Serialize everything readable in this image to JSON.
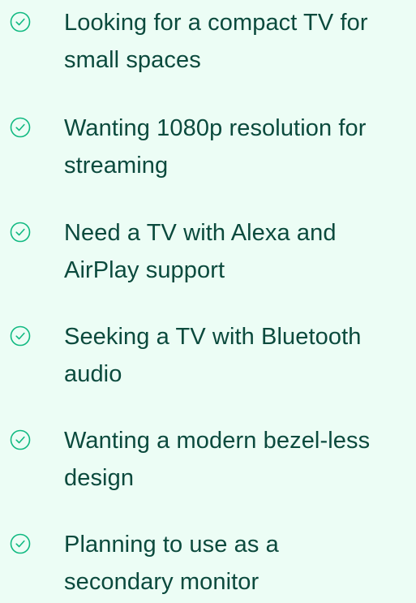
{
  "items": [
    {
      "line1": "Looking for a compact TV for",
      "line2": "small spaces"
    },
    {
      "line1": "Wanting 1080p resolution for",
      "line2": "streaming"
    },
    {
      "line1": "Need a TV with Alexa and",
      "line2": "AirPlay support"
    },
    {
      "line1": "Seeking a TV with Bluetooth",
      "line2": "audio"
    },
    {
      "line1": "Wanting a modern bezel-less",
      "line2": "design"
    },
    {
      "line1": "Planning to use as a",
      "line2": "secondary monitor"
    }
  ],
  "icon": "check-circle-icon",
  "colors": {
    "background": "#ecfdf5",
    "text": "#0b4a3d",
    "accent": "#10b981"
  }
}
